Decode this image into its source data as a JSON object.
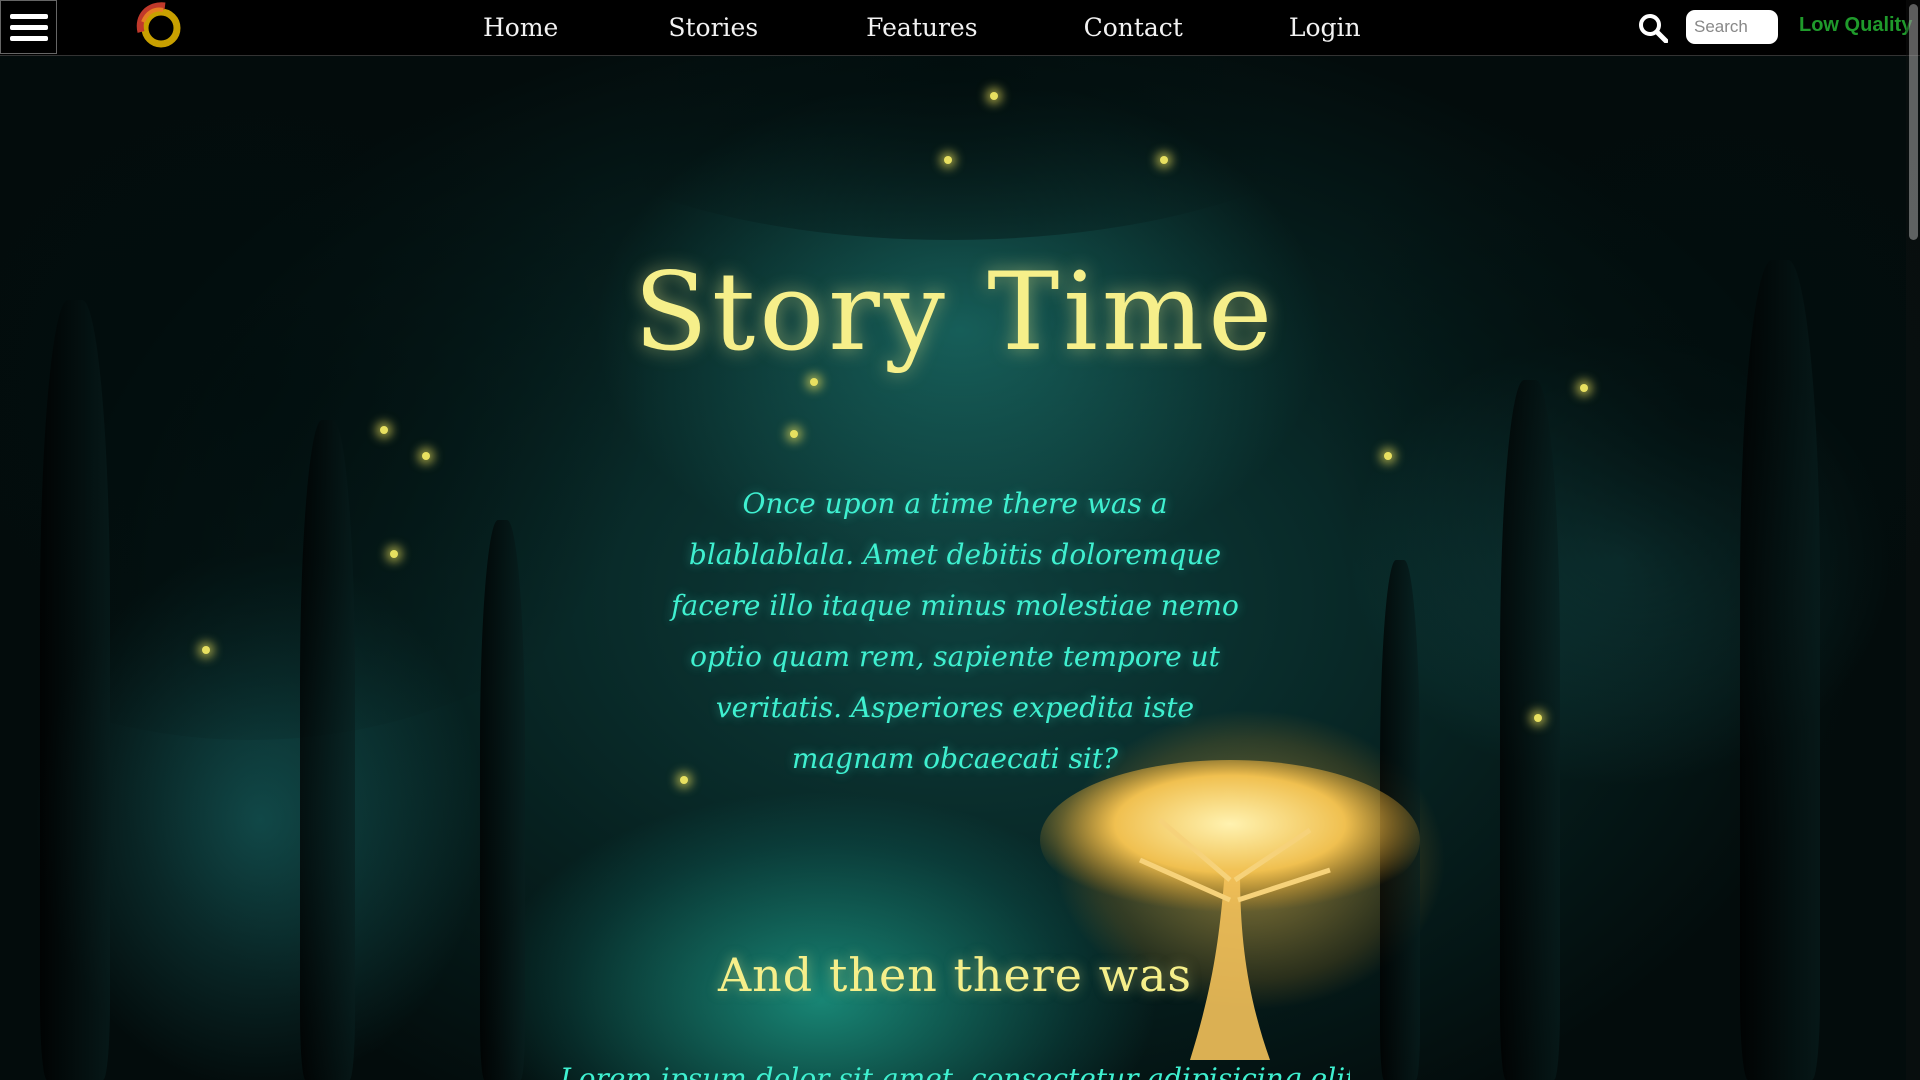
{
  "nav": {
    "menu_icon": "hamburger-menu-icon",
    "logo_icon": "ring-logo-icon",
    "links": [
      {
        "label": "Home"
      },
      {
        "label": "Stories"
      },
      {
        "label": "Features"
      },
      {
        "label": "Contact"
      },
      {
        "label": "Login"
      }
    ],
    "search_icon": "magnifier-icon",
    "search": {
      "placeholder": "Search",
      "value": ""
    },
    "quality_toggle": "Low Quality"
  },
  "hero": {
    "title": "Story Time",
    "intro": "Once upon a time there was a blablablala. Amet debitis doloremque facere illo itaque minus molestiae nemo optio quam rem, sapiente tempore ut veritatis. Asperiores expedita iste magnam obcaecati sit?",
    "subtitle": "And then there was",
    "continuation": "Lorem ipsum dolor sit amet, consectetur adipisicing elit. Asperiores cumque dolo"
  },
  "colors": {
    "title": "#f6ef8a",
    "body_text": "#3ff0d0",
    "quality": "#1f9a2b",
    "navbar": "#000000"
  }
}
